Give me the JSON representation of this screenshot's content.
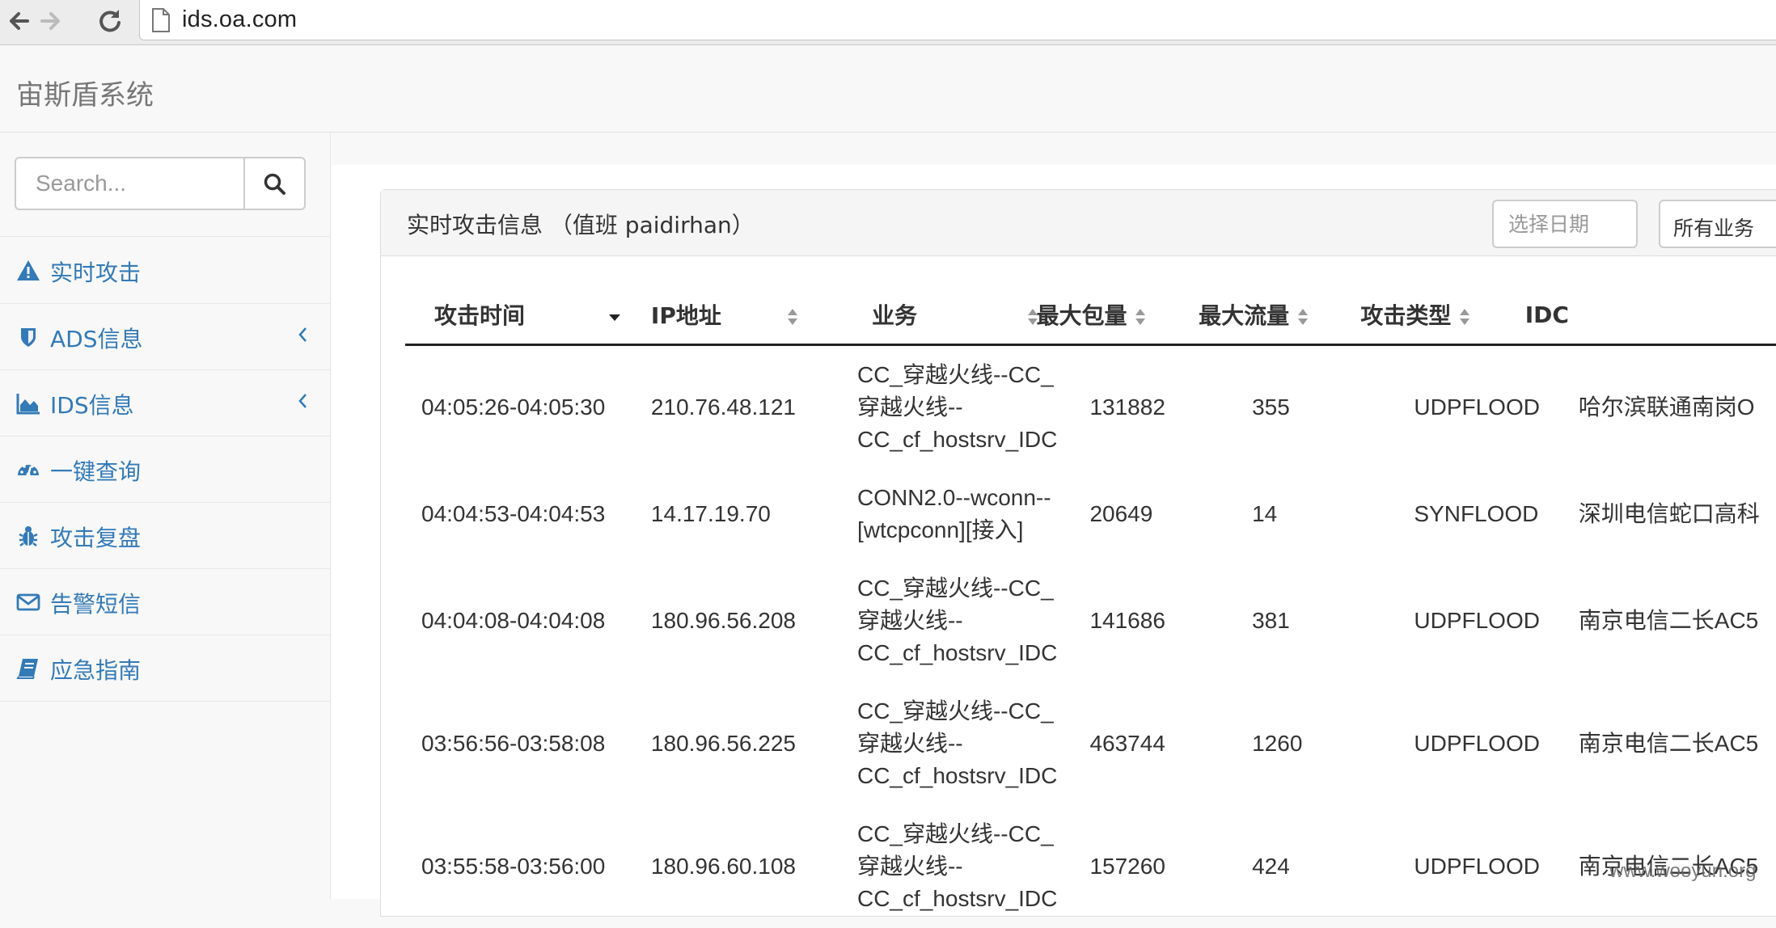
{
  "browser": {
    "url": "ids.oa.com"
  },
  "navbar": {
    "brand": "宙斯盾系统"
  },
  "sidebar": {
    "search_placeholder": "Search...",
    "items": [
      {
        "label": "实时攻击",
        "icon": "warning-icon",
        "has_arrow": false
      },
      {
        "label": "ADS信息",
        "icon": "shield-icon",
        "has_arrow": true
      },
      {
        "label": "IDS信息",
        "icon": "area-chart-icon",
        "has_arrow": true
      },
      {
        "label": "一键查询",
        "icon": "dashboard-icon",
        "has_arrow": false
      },
      {
        "label": "攻击复盘",
        "icon": "bug-icon",
        "has_arrow": false
      },
      {
        "label": "告警短信",
        "icon": "envelope-icon",
        "has_arrow": false
      },
      {
        "label": "应急指南",
        "icon": "book-icon",
        "has_arrow": false
      }
    ]
  },
  "panel": {
    "title": "实时攻击信息 （值班 paidirhan）",
    "date_placeholder": "选择日期",
    "business_select": "所有业务"
  },
  "table": {
    "columns": [
      "攻击时间",
      "IP地址",
      "业务",
      "最大包量",
      "最大流量",
      "攻击类型",
      "IDC"
    ],
    "rows": [
      {
        "time": "04:05:26-04:05:30",
        "ip": "210.76.48.121",
        "biz": [
          "CC_穿越火线--CC_",
          "穿越火线--",
          "CC_cf_hostsrv_IDC"
        ],
        "pkt": "131882",
        "flow": "355",
        "type": "UDPFLOOD",
        "idc": "哈尔滨联通南岗O"
      },
      {
        "time": "04:04:53-04:04:53",
        "ip": "14.17.19.70",
        "biz": [
          "CONN2.0--wconn--",
          "[wtcpconn][接入]"
        ],
        "pkt": "20649",
        "flow": "14",
        "type": "SYNFLOOD",
        "idc": "深圳电信蛇口高科"
      },
      {
        "time": "04:04:08-04:04:08",
        "ip": "180.96.56.208",
        "biz": [
          "CC_穿越火线--CC_",
          "穿越火线--",
          "CC_cf_hostsrv_IDC"
        ],
        "pkt": "141686",
        "flow": "381",
        "type": "UDPFLOOD",
        "idc": "南京电信二长AC5"
      },
      {
        "time": "03:56:56-03:58:08",
        "ip": "180.96.56.225",
        "biz": [
          "CC_穿越火线--CC_",
          "穿越火线--",
          "CC_cf_hostsrv_IDC"
        ],
        "pkt": "463744",
        "flow": "1260",
        "type": "UDPFLOOD",
        "idc": "南京电信二长AC5"
      },
      {
        "time": "03:55:58-03:56:00",
        "ip": "180.96.60.108",
        "biz": [
          "CC_穿越火线--CC_",
          "穿越火线--",
          "CC_cf_hostsrv_IDC"
        ],
        "pkt": "157260",
        "flow": "424",
        "type": "UDPFLOOD",
        "idc": "南京电信二长AC5"
      }
    ]
  },
  "watermark": "www.wooyun.org"
}
